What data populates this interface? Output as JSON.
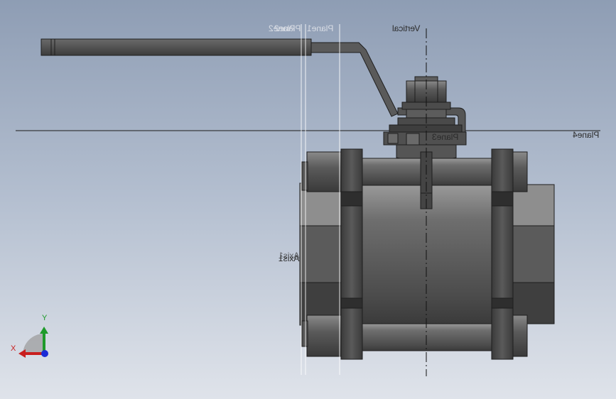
{
  "viewport": {
    "reference_labels": {
      "vertical": "Vertical",
      "plane1": "Plane1",
      "plane2": "Plane2",
      "plane2_overlap": "Plane2",
      "plane3": "Plane3",
      "plane4": "Plane4",
      "axis1": "Axis1",
      "axis1_overlap": "Axis1"
    }
  },
  "triad": {
    "x_label": "X",
    "y_label": "Y",
    "colors": {
      "x": "#c81e1e",
      "y": "#1e9a2a",
      "z": "#1b2bd6"
    }
  },
  "colors": {
    "body_dark": "#3f3f3f",
    "body_mid": "#6a6a6a",
    "body_light": "#8c8c8c",
    "edge": "#1e1e1e",
    "plane_line": "#ffffff"
  }
}
